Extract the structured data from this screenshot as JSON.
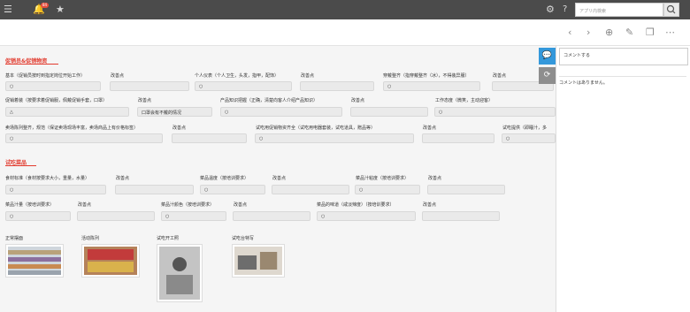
{
  "topbar": {
    "menu_icon": "hamburger-icon",
    "notification_count": "84",
    "search_placeholder": "アプリ内検索"
  },
  "toolbar": {
    "icons": [
      "chevron-left-icon",
      "chevron-right-icon",
      "plus-icon",
      "edit-icon",
      "copy-icon",
      "more-icon"
    ]
  },
  "sections": {
    "promo": {
      "title": "促销员&促销物资"
    },
    "tasting": {
      "title": "试吃菜品"
    }
  },
  "promo_fields": {
    "r1": [
      {
        "label": "基本（促销员按时到指定岗位开始工作）",
        "value": "○"
      },
      {
        "label": "改善点",
        "value": ""
      },
      {
        "label": "个人仪表（个人卫生，头发，指甲，配饰）",
        "value": "○"
      },
      {
        "label": "改善点",
        "value": ""
      },
      {
        "label": "穿戴整齐（指穿戴整齐（冰），不得装异服）",
        "value": "○"
      },
      {
        "label": "改善点",
        "value": ""
      }
    ],
    "r2": [
      {
        "label": "促销着装（按要求着促销服，佩戴促销手套，口罩）",
        "value": "△"
      },
      {
        "label": "改善点",
        "value": "口罩会有不戴的情况"
      },
      {
        "label": "产品知识把握（正确，清楚向客人介绍产品知识）",
        "value": "○"
      },
      {
        "label": "改善点",
        "value": ""
      },
      {
        "label": "工作态度（微笑，主动迎客）",
        "value": "○"
      }
    ],
    "r3": [
      {
        "label": "卖场陈列整齐，规范（保证卖场现场丰富，卖场商品上有价格标签）",
        "value": "○"
      },
      {
        "label": "改善点",
        "value": ""
      },
      {
        "label": "试吃用促销物资齐全（试吃用电器套装，试吃道具，赠品等）",
        "value": "○"
      },
      {
        "label": "改善点",
        "value": ""
      },
      {
        "label": "试吃提供（即睡汁，多",
        "value": "○"
      }
    ]
  },
  "tasting_fields": {
    "r1": [
      {
        "label": "食材标准（食材按要求大小，重量，水量）",
        "value": "○"
      },
      {
        "label": "改善点",
        "value": ""
      },
      {
        "label": "菜品温度（按培训要求）",
        "value": "○"
      },
      {
        "label": "改善点",
        "value": ""
      },
      {
        "label": "菜品汁粘度（按培训要求）",
        "value": "○"
      },
      {
        "label": "改善点",
        "value": ""
      }
    ],
    "r2": [
      {
        "label": "菜品汁量（按培训要求）",
        "value": "○"
      },
      {
        "label": "改善点",
        "value": ""
      },
      {
        "label": "菜品汁颜色（按培训要求）",
        "value": "○"
      },
      {
        "label": "改善点",
        "value": ""
      },
      {
        "label": "菜品的味道（咸淡辣度）（按培训要求）",
        "value": "○"
      },
      {
        "label": "改善点",
        "value": ""
      }
    ]
  },
  "photos": [
    {
      "label": "正常摆面"
    },
    {
      "label": "活动陈列"
    },
    {
      "label": "试吃开工照"
    },
    {
      "label": "试吃台特写"
    }
  ],
  "comment_panel": {
    "input_placeholder": "コメントする",
    "empty_message": "コメントはありません。"
  }
}
